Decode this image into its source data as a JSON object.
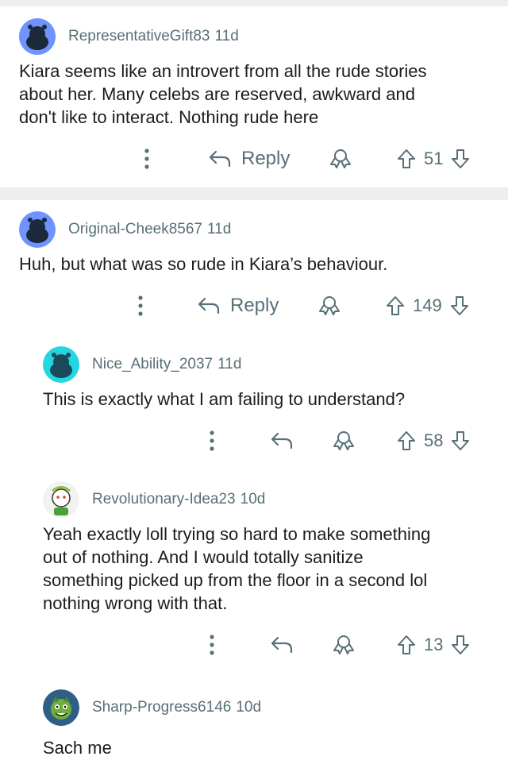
{
  "comments": [
    {
      "username": "RepresentativeGift83",
      "age": "11d",
      "avatar_color": "#7193ff",
      "lines": [
        "Kiara seems like an introvert from all the rude stories",
        "about her. Many celebs are reserved, awkward and",
        "don't like to interact. Nothing rude here"
      ],
      "reply_label": "Reply",
      "votes": "51"
    },
    {
      "username": "Original-Cheek8567",
      "age": "11d",
      "avatar_color": "#7193ff",
      "lines": [
        "Huh, but what was so rude in Kiara’s behaviour."
      ],
      "reply_label": "Reply",
      "votes": "149"
    },
    {
      "username": "Nice_Ability_2037",
      "age": "11d",
      "avatar_color": "#24d6e0",
      "lines": [
        "This is exactly what I am failing to understand?"
      ],
      "votes": "58"
    },
    {
      "username": "Revolutionary-Idea23",
      "age": "10d",
      "avatar_color": "#f2f2f2",
      "lines": [
        "Yeah exactly loll trying so hard to make something",
        "out of nothing. And I would totally sanitize",
        "something picked up from the floor in a second lol",
        "nothing wrong with that."
      ],
      "votes": "13"
    },
    {
      "username": "Sharp-Progress6146",
      "age": "10d",
      "avatar_color": "#2f5f85",
      "lines": [
        "Sach me"
      ]
    }
  ],
  "icons": {
    "more": "more-vertical-icon",
    "reply": "reply-arrow-icon",
    "award": "award-icon",
    "upvote": "upvote-arrow-icon",
    "downvote": "downvote-arrow-icon"
  },
  "colors": {
    "meta_text": "#576f76",
    "body_text": "#1c1c1c",
    "separator": "#eeeeef"
  }
}
